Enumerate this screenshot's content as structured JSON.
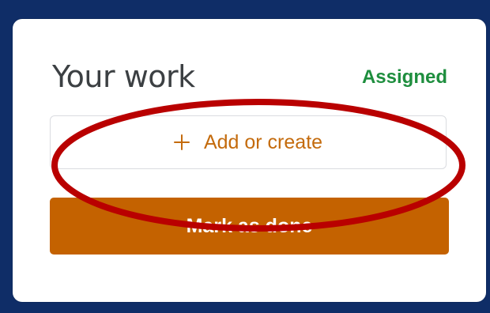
{
  "assignment": {
    "heading": "Your work",
    "status": "Assigned",
    "add_label": "Add or create",
    "done_label": "Mark as done",
    "plus_icon": "plus-icon"
  },
  "colors": {
    "background": "#0f2d67",
    "card": "#ffffff",
    "heading": "#3c4043",
    "status": "#1e8e3e",
    "accent": "#c46b0d",
    "done_button": "#c46200",
    "annotation": "#b90000"
  }
}
